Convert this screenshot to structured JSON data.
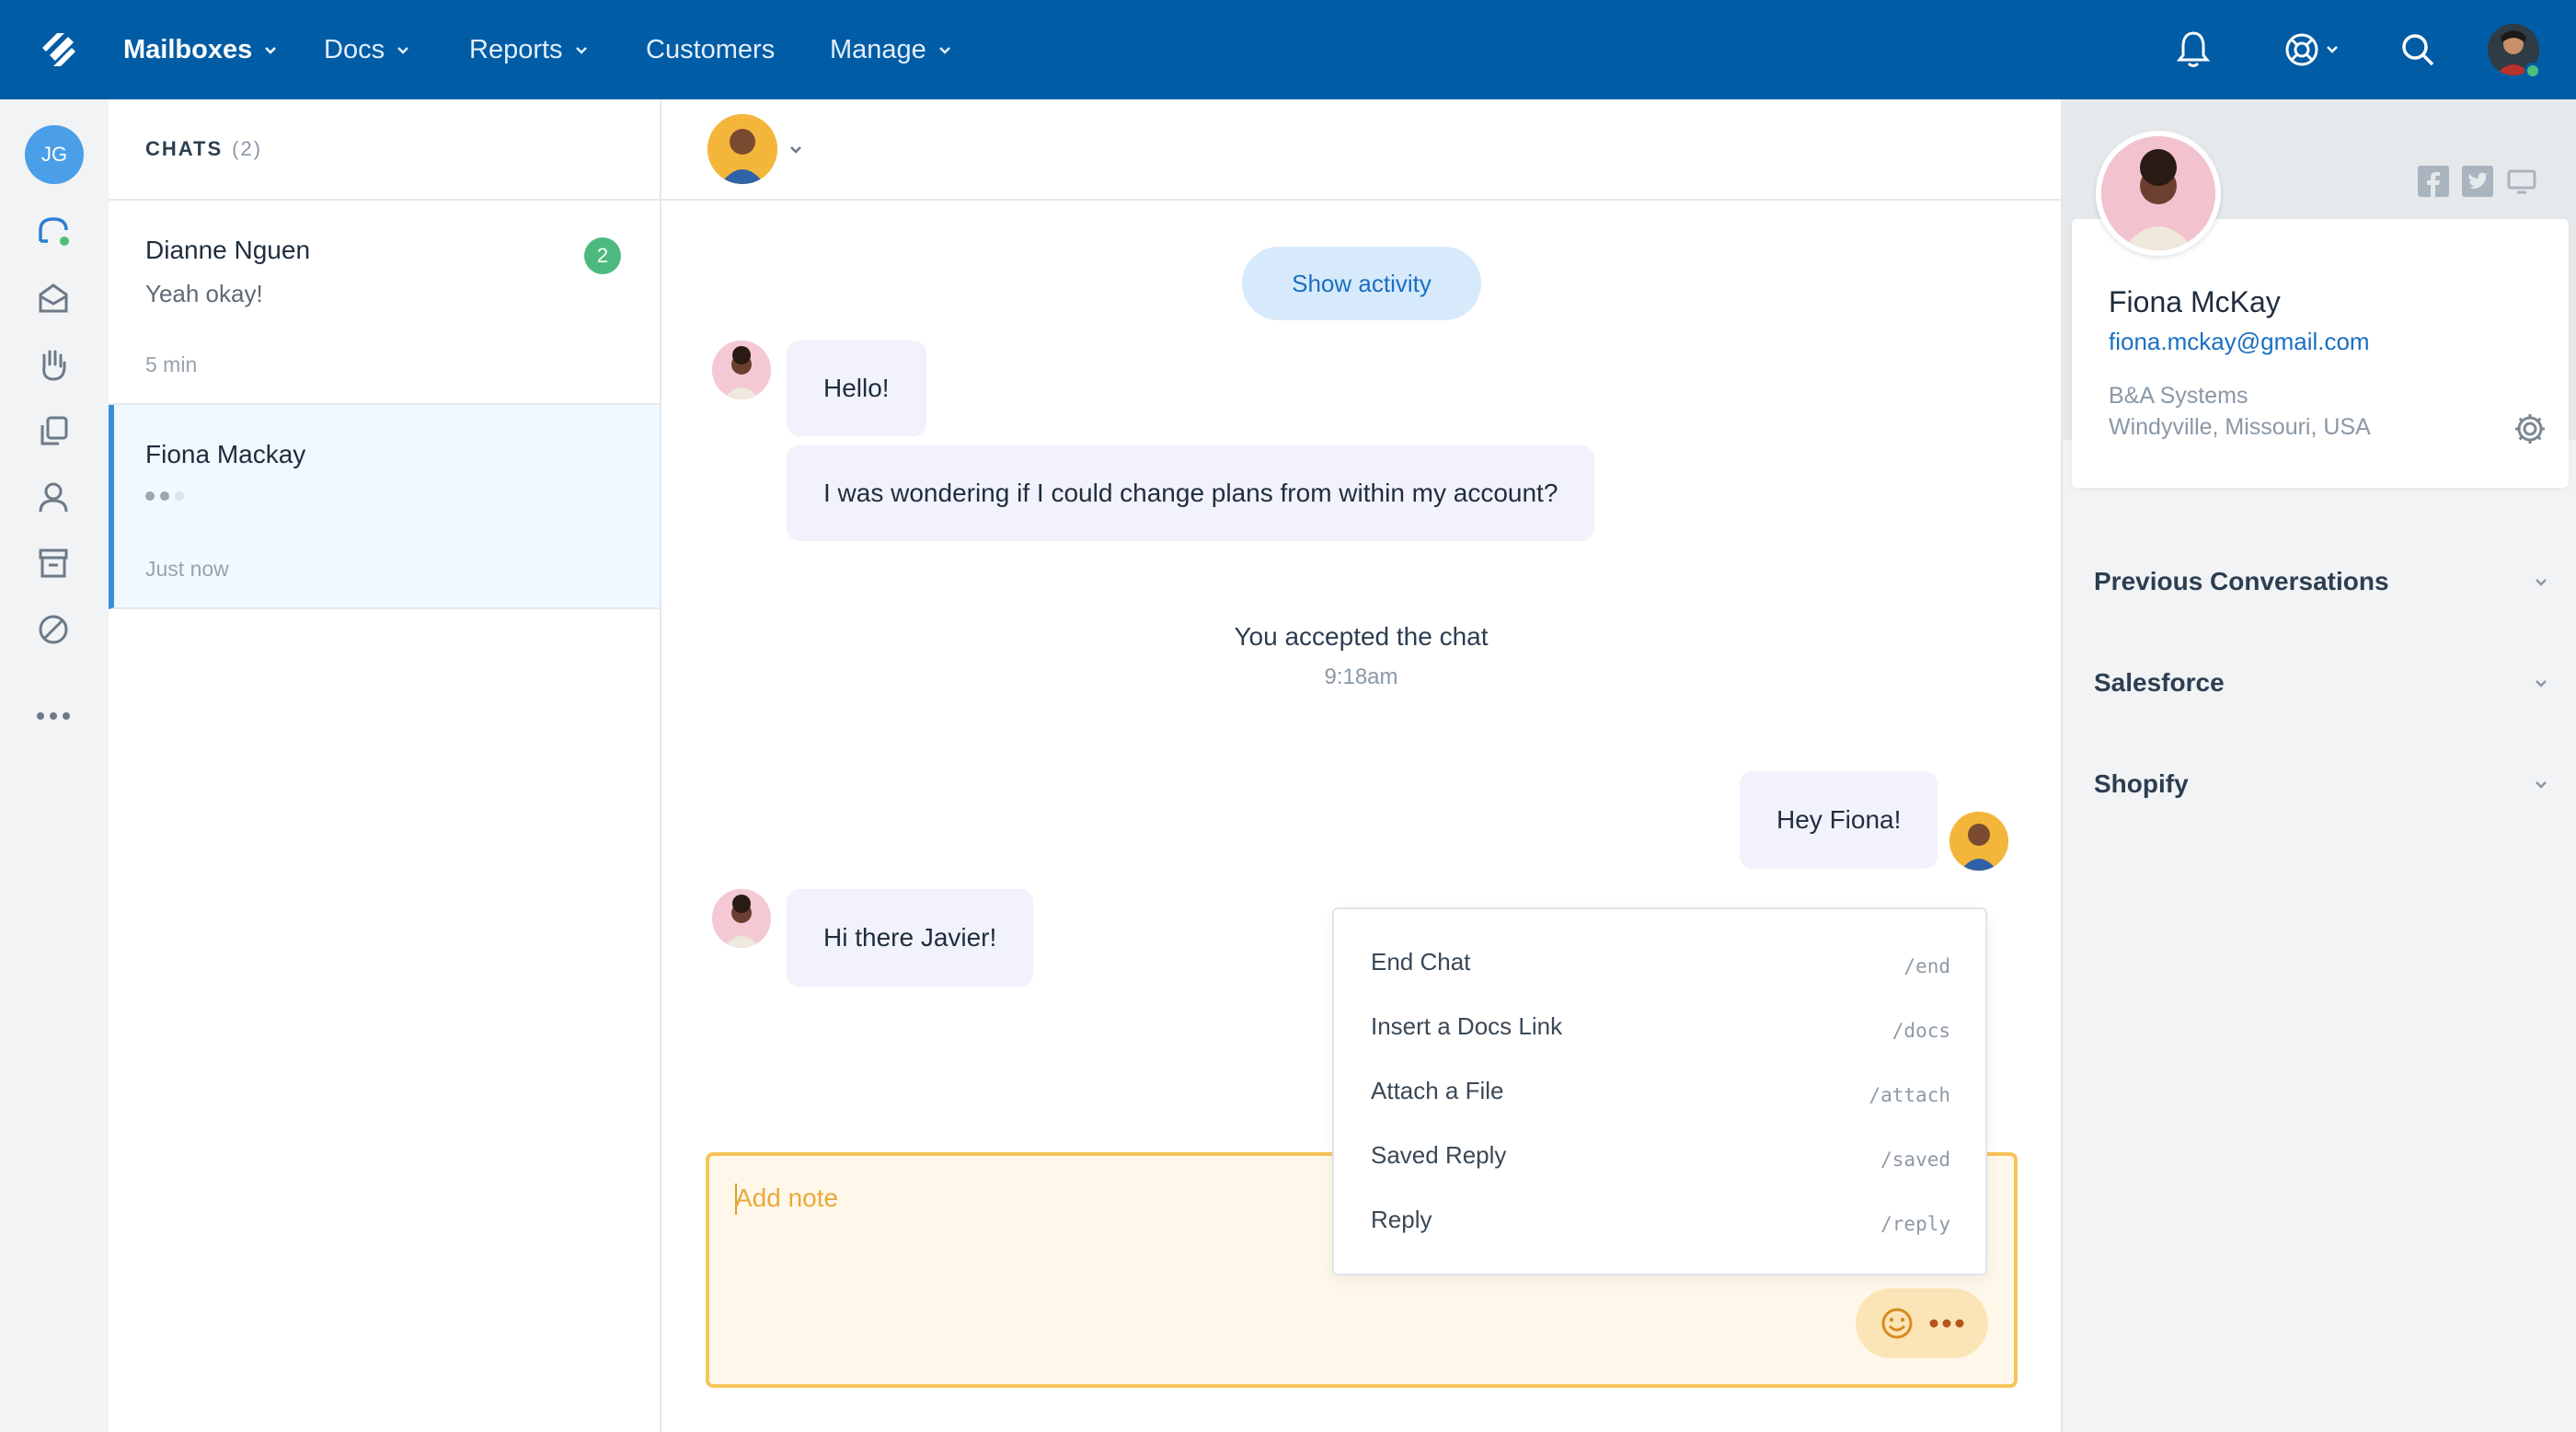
{
  "nav": {
    "items": [
      {
        "label": "Mailboxes",
        "has_menu": true,
        "active": true
      },
      {
        "label": "Docs",
        "has_menu": true
      },
      {
        "label": "Reports",
        "has_menu": true
      },
      {
        "label": "Customers",
        "has_menu": false
      },
      {
        "label": "Manage",
        "has_menu": true
      }
    ],
    "icons": [
      "bell-icon",
      "help-lifebuoy-icon",
      "search-icon",
      "user-avatar"
    ]
  },
  "rail": {
    "user_initials": "JG",
    "icons": [
      "chat-icon",
      "inbox-icon",
      "hand-icon",
      "docs-icon",
      "customer-icon",
      "archive-icon",
      "blocked-icon",
      "more-icon"
    ]
  },
  "chatlist": {
    "title": "CHATS",
    "count": "(2)",
    "items": [
      {
        "name": "Dianne Nguen",
        "preview": "Yeah okay!",
        "time": "5 min",
        "unread": "2"
      },
      {
        "name": "Fiona Mackay",
        "preview": "",
        "time": "Just now",
        "typing": true
      }
    ]
  },
  "conversation": {
    "show_activity_label": "Show activity",
    "messages": [
      {
        "from": "customer",
        "text": "Hello!"
      },
      {
        "from": "customer",
        "text": "I was wondering if I could change plans from within my account?"
      },
      {
        "from": "agent",
        "text": "Hey Fiona!"
      },
      {
        "from": "customer",
        "text": "Hi there Javier!"
      }
    ],
    "system_event": {
      "text": "You accepted the chat",
      "time": "9:18am"
    },
    "composer": {
      "placeholder": "Add note"
    },
    "commands": [
      {
        "label": "End Chat",
        "shortcut": "/end"
      },
      {
        "label": "Insert a Docs Link",
        "shortcut": "/docs"
      },
      {
        "label": "Attach a File",
        "shortcut": "/attach"
      },
      {
        "label": "Saved Reply",
        "shortcut": "/saved"
      },
      {
        "label": "Reply",
        "shortcut": "/reply"
      }
    ]
  },
  "profile": {
    "name": "Fiona McKay",
    "email": "fiona.mckay@gmail.com",
    "company": "B&A Systems",
    "location": "Windyville, Missouri, USA",
    "social_icons": [
      "facebook-icon",
      "twitter-icon",
      "monitor-icon"
    ]
  },
  "sidebar_sections": [
    {
      "label": "Previous Conversations"
    },
    {
      "label": "Salesforce"
    },
    {
      "label": "Shopify"
    }
  ],
  "colors": {
    "brand_blue": "#005ca4",
    "link_blue": "#1a6fc2",
    "unread_green": "#4cba7e",
    "note_border": "#f6c55a",
    "note_bg": "#fff8ea"
  }
}
